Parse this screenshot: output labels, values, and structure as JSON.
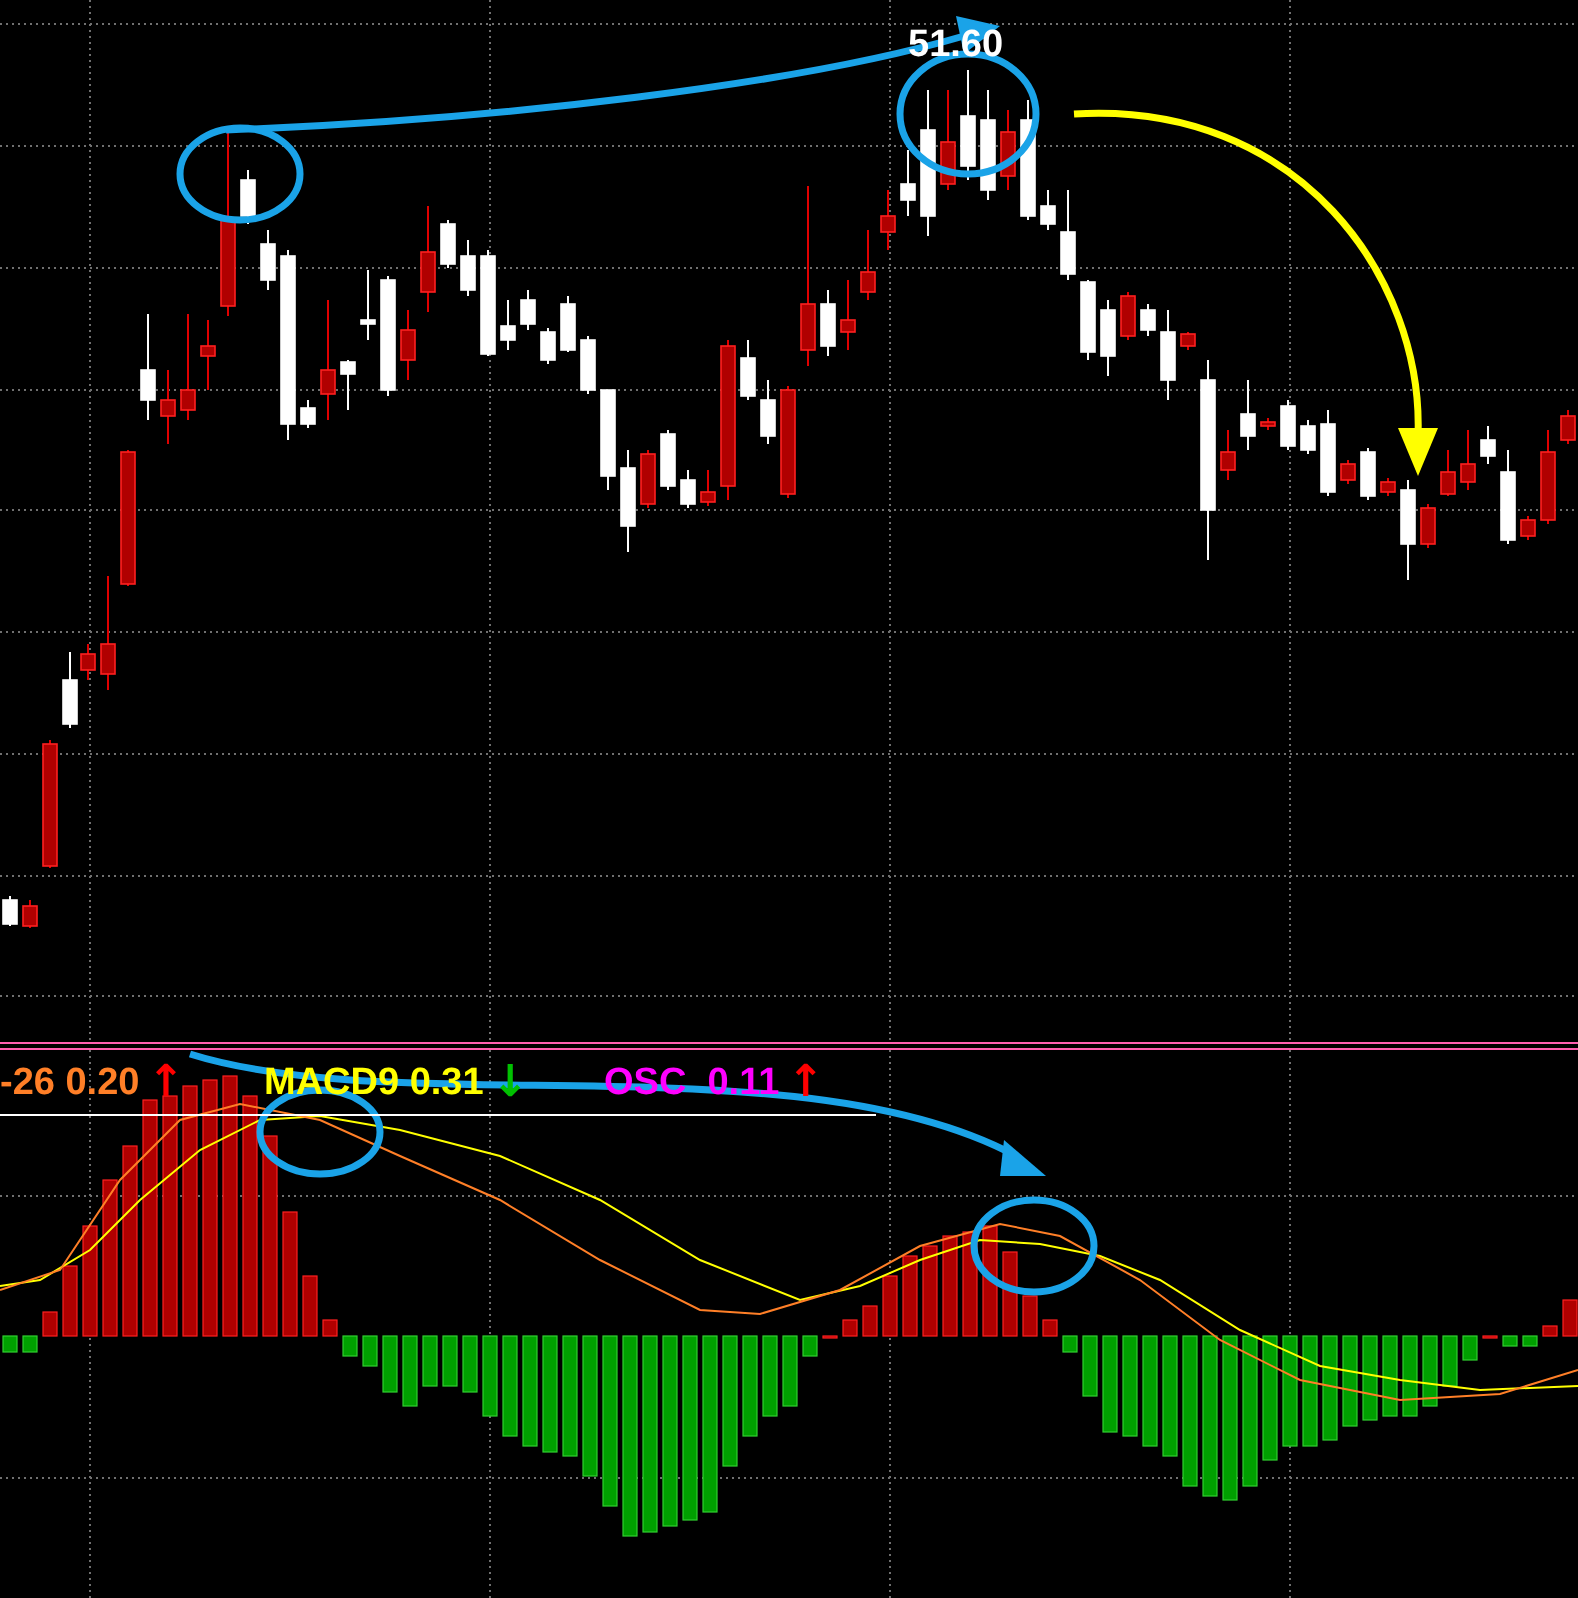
{
  "price_chart": {
    "peak_label": "51.60"
  },
  "macd_panel": {
    "legend": [
      {
        "text": "-26 0.20",
        "color": "#ff7f27",
        "arrow": {
          "glyph": "↑",
          "color": "#ff0000"
        }
      },
      {
        "text": "MACD9 0.31",
        "color": "#ffff00",
        "arrow": {
          "glyph": "↓",
          "color": "#00c000"
        }
      },
      {
        "text": "OSC  0.11",
        "color": "#ff00ff",
        "arrow": {
          "glyph": "↑",
          "color": "#ff0000"
        }
      }
    ]
  }
}
